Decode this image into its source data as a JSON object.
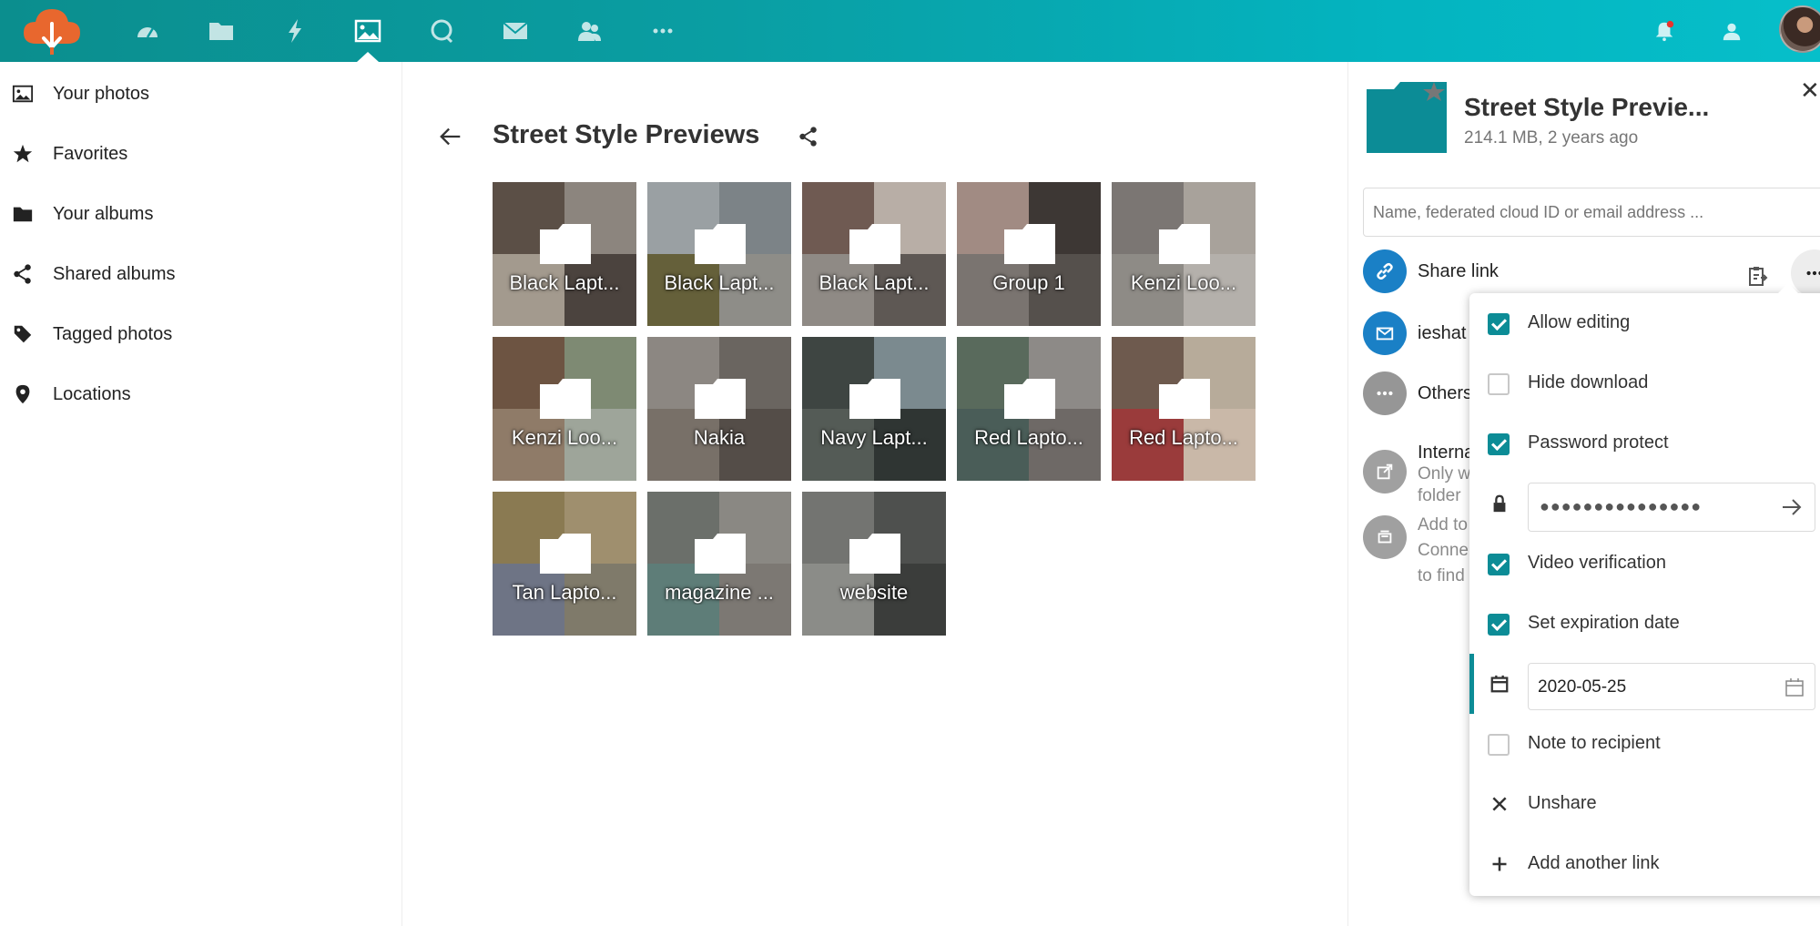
{
  "header": {
    "apps": [
      {
        "name": "Dashboard",
        "icon": "dashboard-icon"
      },
      {
        "name": "Files",
        "icon": "folder-icon"
      },
      {
        "name": "Activity",
        "icon": "lightning-icon"
      },
      {
        "name": "Photos",
        "icon": "image-icon",
        "active": true
      },
      {
        "name": "Talk",
        "icon": "chat-icon"
      },
      {
        "name": "Mail",
        "icon": "mail-icon"
      },
      {
        "name": "Contacts",
        "icon": "contacts-icon"
      },
      {
        "name": "More apps",
        "icon": "more-icon"
      }
    ],
    "colors": {
      "from": "#0b8e8e",
      "to": "#06bfca",
      "logo": "#e8672e"
    }
  },
  "nav": {
    "items": [
      {
        "label": "Your photos",
        "icon": "image-icon"
      },
      {
        "label": "Favorites",
        "icon": "star-icon"
      },
      {
        "label": "Your albums",
        "icon": "folder-icon"
      },
      {
        "label": "Shared albums",
        "icon": "share-icon"
      },
      {
        "label": "Tagged photos",
        "icon": "tag-icon"
      },
      {
        "label": "Locations",
        "icon": "location-pin-icon"
      }
    ]
  },
  "main": {
    "title": "Street Style Previews",
    "folders": [
      {
        "name": "Black Lapt..."
      },
      {
        "name": "Black Lapt..."
      },
      {
        "name": "Black Lapt..."
      },
      {
        "name": "Group 1"
      },
      {
        "name": "Kenzi Loo..."
      },
      {
        "name": "Kenzi Loo..."
      },
      {
        "name": "Nakia"
      },
      {
        "name": "Navy Lapt..."
      },
      {
        "name": "Red Lapto..."
      },
      {
        "name": "Red Lapto..."
      },
      {
        "name": "Tan Lapto..."
      },
      {
        "name": "magazine ..."
      },
      {
        "name": "website"
      }
    ]
  },
  "sidebar": {
    "title": "Street Style Previe...",
    "subtitle": "214.1 MB, 2 years ago",
    "share_placeholder": "Name, federated cloud ID or email address ...",
    "share_link_label": "Share link",
    "email_share_label": "ieshat",
    "others_label": "Others",
    "internal_lines": [
      "Interna",
      "Only w",
      "folder"
    ],
    "add_lines": [
      "Add to",
      "Conne",
      "to find"
    ],
    "accent": "#0c8c96",
    "link_circle_color": "#1a80c6"
  },
  "popover": {
    "items": [
      {
        "label": "Allow editing",
        "checked": true
      },
      {
        "label": "Hide download",
        "checked": false
      },
      {
        "label": "Password protect",
        "checked": true
      },
      {
        "label": "Video verification",
        "checked": true
      },
      {
        "label": "Set expiration date",
        "checked": true
      },
      {
        "label": "Note to recipient",
        "checked": false
      }
    ],
    "password_mask": "●●●●●●●●●●●●●●●",
    "expiration_date": "2020-05-25",
    "unshare_label": "Unshare",
    "add_link_label": "Add another link"
  }
}
